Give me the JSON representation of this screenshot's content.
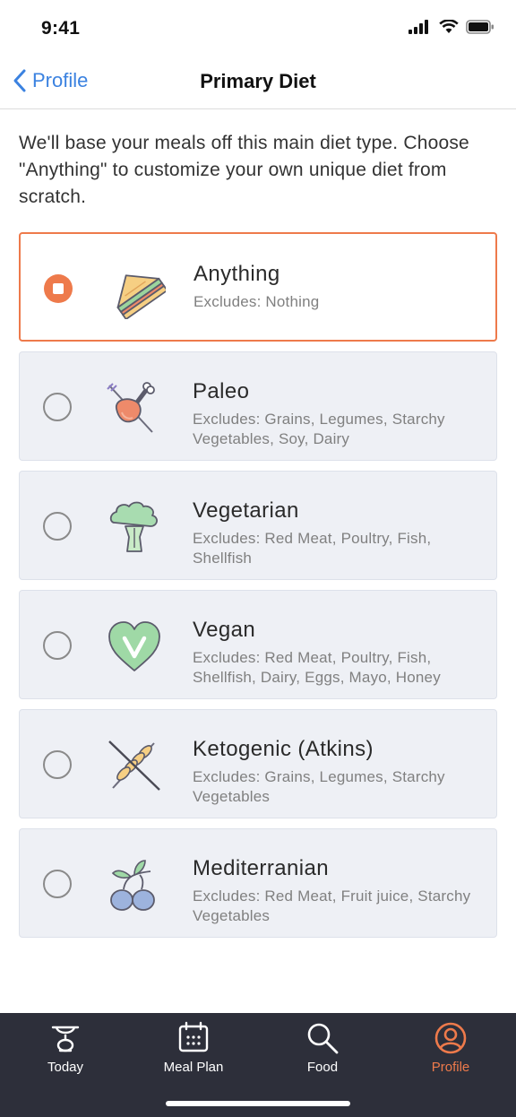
{
  "status_bar": {
    "time": "9:41",
    "icons": [
      "signal-icon",
      "wifi-icon",
      "battery-icon"
    ]
  },
  "nav": {
    "back_label": "Profile",
    "title": "Primary Diet"
  },
  "intro_text": "We'll base your meals off this main diet type. Choose \"Anything\" to customize your own unique diet from scratch.",
  "diets": [
    {
      "name": "Anything",
      "excludes": "Excludes: Nothing",
      "icon": "sandwich-icon",
      "selected": true
    },
    {
      "name": "Paleo",
      "excludes": "Excludes: Grains, Legumes, Starchy Vegetables, Soy, Dairy",
      "icon": "drumstick-icon",
      "selected": false
    },
    {
      "name": "Vegetarian",
      "excludes": "Excludes: Red Meat, Poultry, Fish, Shellfish",
      "icon": "broccoli-icon",
      "selected": false
    },
    {
      "name": "Vegan",
      "excludes": "Excludes: Red Meat, Poultry, Fish, Shellfish, Dairy, Eggs, Mayo, Honey",
      "icon": "vegan-heart-icon",
      "selected": false
    },
    {
      "name": "Ketogenic (Atkins)",
      "excludes": "Excludes: Grains, Legumes, Starchy Vegetables",
      "icon": "no-grain-icon",
      "selected": false
    },
    {
      "name": "Mediterranian",
      "excludes": "Excludes: Red Meat, Fruit juice, Starchy Vegetables",
      "icon": "olives-icon",
      "selected": false
    }
  ],
  "tab_bar": {
    "items": [
      {
        "label": "Today",
        "icon": "scale-icon",
        "active": false
      },
      {
        "label": "Meal Plan",
        "icon": "calendar-icon",
        "active": false
      },
      {
        "label": "Food",
        "icon": "search-icon",
        "active": false
      },
      {
        "label": "Profile",
        "icon": "profile-icon",
        "active": true
      }
    ]
  },
  "colors": {
    "accent": "#ee7a4b",
    "link": "#3b82e0",
    "card_bg": "#eef0f5",
    "tab_bar_bg": "#2d2f3a"
  }
}
